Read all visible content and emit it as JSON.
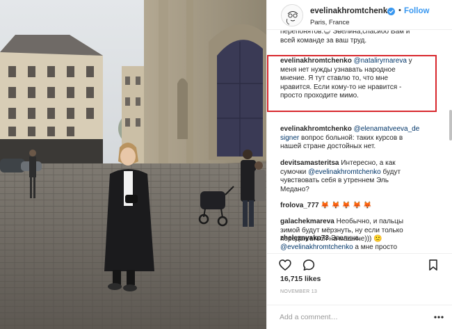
{
  "post": {
    "author": "evelinakhromtchenko",
    "follow_label": "Follow",
    "separator": "•",
    "location": "Paris, France",
    "likes": "16,715 likes",
    "date": "NOVEMBER 13",
    "add_comment_placeholder": "Add a comment…"
  },
  "comments": [
    {
      "text_lines": [
        "перепонятов.😊 Эвелина,спасибо Вам и",
        "всей команде за ваш труд."
      ]
    },
    {
      "user": "evelinakhromtchenko",
      "mention": "@nataliryrnareva",
      "line1_rest": " у",
      "lines": [
        "меня нет нужды узнавать народное",
        "мнение. Я тут ставлю то, что мне",
        "нравится. Если кому-то не нравится -",
        "просто проходите мимо."
      ]
    },
    {
      "user": "evelinakhromtchenko",
      "mention": "@elenamatveeva_de",
      "mention_cont": "signer",
      "line2_rest": " вопрос больной: таких курсов в",
      "lines": [
        "нашей стране достойных нет."
      ]
    },
    {
      "user": "devitsamasteritsa",
      "line1_rest": " Интересно, а как",
      "line2_pre": "сумочки ",
      "mention": "@evelinakhromtchenko",
      "line2_rest": " будут",
      "lines": [
        "чувствовать себя в утреннем Эль",
        "Медано?"
      ]
    },
    {
      "user": "frolova_777",
      "line1_rest": " 🦊 🦊 🦊 🦊 🦊"
    },
    {
      "user": "galachekmareva",
      "line1_rest": " Необычно, и пальцы",
      "lines": [
        "зимой будут мёрзнуть, ну если только",
        "передвигаться на машине))) 🙁"
      ]
    },
    {
      "user": "zheleznyakn73",
      "line1_rest": " Эвелина,",
      "mention": "@evelinakhromtchenko",
      "line2_rest": " а мне просто"
    }
  ],
  "colors": {
    "accent": "#3897f0",
    "mention": "#003569",
    "highlight": "#d8262c",
    "text": "#262626",
    "muted": "#999999"
  },
  "icons": {
    "verified": "verified-badge-icon",
    "like": "heart-icon",
    "comment": "comment-bubble-icon",
    "save": "bookmark-icon",
    "more": "more-options-icon"
  }
}
